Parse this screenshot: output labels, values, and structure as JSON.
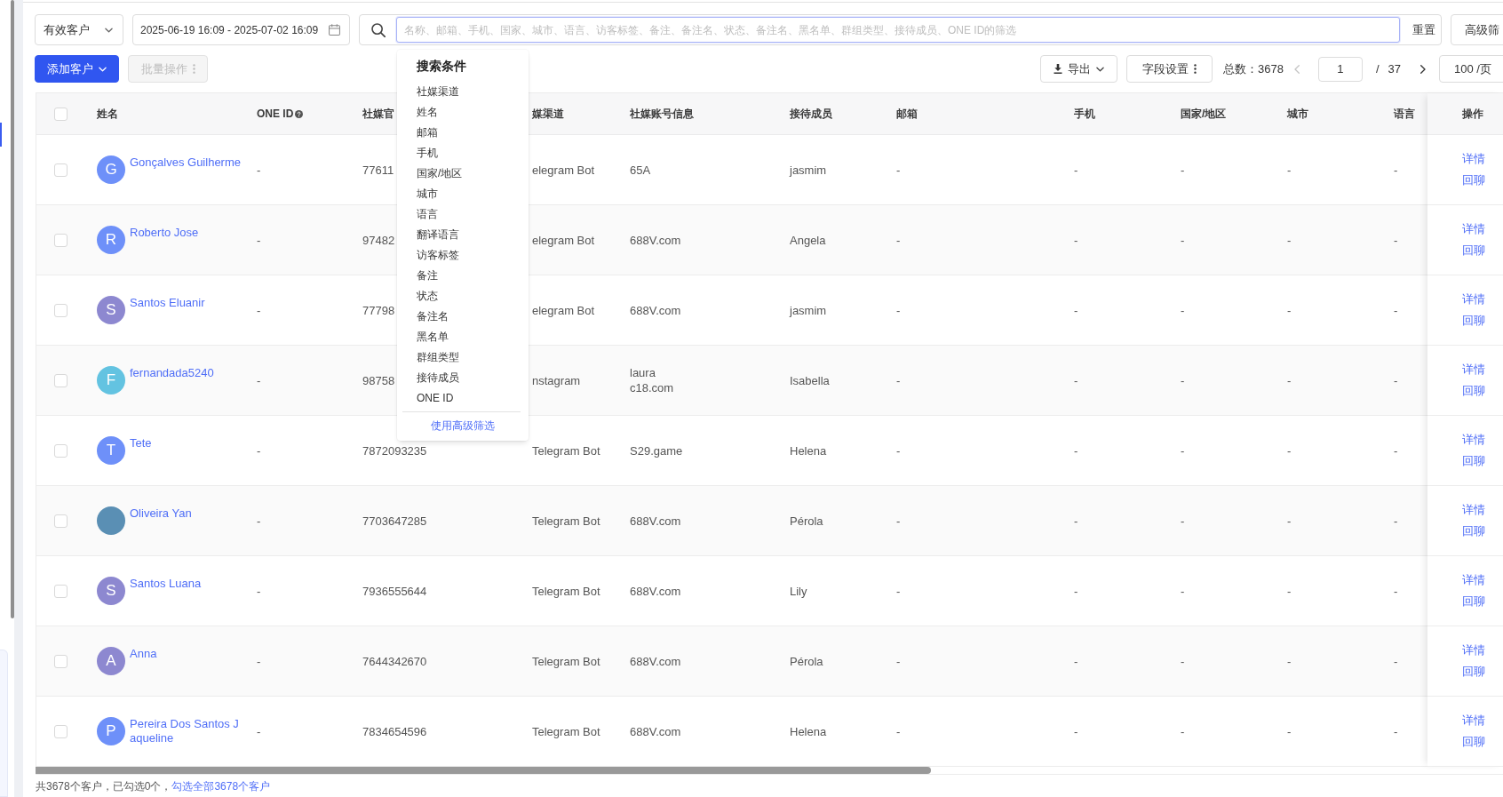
{
  "filters": {
    "customer_type": "有效客户",
    "date_range": "2025-06-19 16:09 - 2025-07-02 16:09",
    "search": {
      "placeholder": "名称、邮箱、手机、国家、城市、语言、访客标签、备注、备注名、状态、备注名、黑名单、群组类型、接待成员、ONE ID的筛选",
      "focused": true
    },
    "reset_button": "重置",
    "advanced_button": "高级筛"
  },
  "toolbar": {
    "add_button": "添加客户",
    "batch_button": {
      "label": "批量操作",
      "disabled": true
    },
    "export_button": "导出",
    "fields_button": "字段设置",
    "total": "总数：3678",
    "pagination": {
      "prev": {
        "disabled": true
      },
      "page": "1",
      "separator": "/",
      "page_count": "37",
      "next": {
        "disabled": false
      },
      "page_size": "100 /页"
    }
  },
  "search_dropdown": {
    "title": "搜索条件",
    "options": [
      "社媒渠道",
      "姓名",
      "邮箱",
      "手机",
      "国家/地区",
      "城市",
      "语言",
      "翻译语言",
      "访客标签",
      "备注",
      "状态",
      "备注名",
      "黑名单",
      "群组类型",
      "接待成员",
      "ONE ID"
    ],
    "advanced_link": "使用高级筛选"
  },
  "table": {
    "select_all": {
      "checked": false
    },
    "columns": [
      {
        "label": "姓名",
        "kind": "name"
      },
      {
        "label": "ONE ID",
        "kind": "text",
        "help": true
      },
      {
        "label": "社媒官",
        "kind": "text"
      },
      {
        "label": "媒渠道",
        "kind": "text"
      },
      {
        "label": "社媒账号信息",
        "kind": "text"
      },
      {
        "label": "接待成员",
        "kind": "text"
      },
      {
        "label": "邮箱",
        "kind": "text"
      },
      {
        "label": "手机",
        "kind": "text"
      },
      {
        "label": "国家/地区",
        "kind": "text"
      },
      {
        "label": "城市",
        "kind": "text"
      },
      {
        "label": "语言",
        "kind": "text"
      },
      {
        "label": "操作",
        "kind": "actions"
      }
    ],
    "rows": [
      {
        "checked": false,
        "avatar": {
          "kind": "letter",
          "initial": "G",
          "color": "#6e90f9"
        },
        "cells": [
          "Gonçalves Guilherme",
          "-",
          "77611",
          "elegram Bot",
          "65A",
          "jasmim",
          "-",
          "-",
          "-",
          "-",
          "-",
          [
            "详情",
            "回聊"
          ]
        ]
      },
      {
        "checked": false,
        "avatar": {
          "kind": "letter",
          "initial": "R",
          "color": "#6e90f9"
        },
        "cells": [
          "Roberto Jose",
          "-",
          "97482",
          "elegram Bot",
          "688V.com",
          "Angela",
          "-",
          "-",
          "-",
          "-",
          "-",
          [
            "详情",
            "回聊"
          ]
        ]
      },
      {
        "checked": false,
        "avatar": {
          "kind": "letter",
          "initial": "S",
          "color": "#8d88d0"
        },
        "cells": [
          "Santos Eluanir",
          "-",
          "77798",
          "elegram Bot",
          "688V.com",
          "jasmim",
          "-",
          "-",
          "-",
          "-",
          "-",
          [
            "详情",
            "回聊"
          ]
        ]
      },
      {
        "checked": false,
        "avatar": {
          "kind": "letter",
          "initial": "F",
          "color": "#63c3e1"
        },
        "cells": [
          "fernandada5240",
          "-",
          "98758",
          "nstagram",
          "laura\nc18.com",
          "Isabella",
          "-",
          "-",
          "-",
          "-",
          "-",
          [
            "详情",
            "回聊"
          ]
        ]
      },
      {
        "checked": false,
        "avatar": {
          "kind": "letter",
          "initial": "T",
          "color": "#6e90f9"
        },
        "cells": [
          "Tete",
          "-",
          "7872093235",
          "Telegram Bot",
          "S29.game",
          "Helena",
          "-",
          "-",
          "-",
          "-",
          "-",
          [
            "详情",
            "回聊"
          ]
        ]
      },
      {
        "checked": false,
        "avatar": {
          "kind": "photo"
        },
        "cells": [
          "Oliveira Yan",
          "-",
          "7703647285",
          "Telegram Bot",
          "688V.com",
          "Pérola",
          "-",
          "-",
          "-",
          "-",
          "-",
          [
            "详情",
            "回聊"
          ]
        ]
      },
      {
        "checked": false,
        "avatar": {
          "kind": "letter",
          "initial": "S",
          "color": "#8d88d0"
        },
        "cells": [
          "Santos Luana",
          "-",
          "7936555644",
          "Telegram Bot",
          "688V.com",
          "Lily",
          "-",
          "-",
          "-",
          "-",
          "-",
          [
            "详情",
            "回聊"
          ]
        ]
      },
      {
        "checked": false,
        "avatar": {
          "kind": "letter",
          "initial": "A",
          "color": "#8d88d0"
        },
        "cells": [
          "Anna",
          "-",
          "7644342670",
          "Telegram Bot",
          "688V.com",
          "Pérola",
          "-",
          "-",
          "-",
          "-",
          "-",
          [
            "详情",
            "回聊"
          ]
        ]
      },
      {
        "checked": false,
        "avatar": {
          "kind": "letter",
          "initial": "P",
          "color": "#6e90f9"
        },
        "cells": [
          "Pereira Dos Santos Jaqueline",
          "-",
          "7834654596",
          "Telegram Bot",
          "688V.com",
          "Helena",
          "-",
          "-",
          "-",
          "-",
          "-",
          [
            "详情",
            "回聊"
          ]
        ]
      }
    ]
  },
  "footer": {
    "summary": "共3678个客户，已勾选0个，",
    "select_all_link": "勾选全部3678个客户"
  }
}
